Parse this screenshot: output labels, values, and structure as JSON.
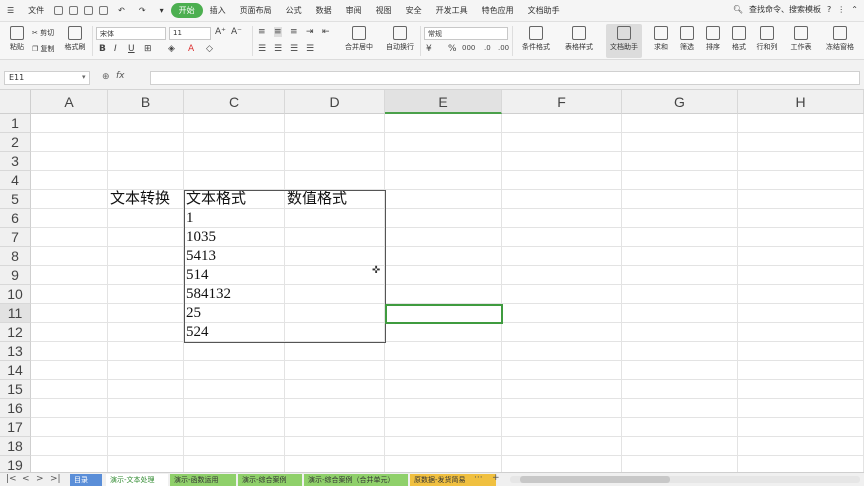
{
  "menubar": {
    "file": "文件",
    "items": [
      "开始",
      "插入",
      "页面布局",
      "公式",
      "数据",
      "审阅",
      "视图",
      "安全",
      "开发工具",
      "特色应用",
      "文档助手"
    ],
    "active_index": 0,
    "search": "查找命令、搜索模板",
    "help": "?"
  },
  "ribbon": {
    "cut": "剪切",
    "paste": "粘贴",
    "copy": "复制",
    "format_painter": "格式刷",
    "font_name": "宋体",
    "font_size": "11",
    "merge_center": "合并居中",
    "auto_wrap": "自动换行",
    "number_format": "常规",
    "conditional_format": "条件格式",
    "table_style": "表格样式",
    "doc_helper": "文档助手",
    "sum": "求和",
    "filter": "筛选",
    "sort": "排序",
    "format": "格式",
    "row_col": "行和列",
    "worksheet": "工作表",
    "freeze": "冻结窗格",
    "bold": "B",
    "italic": "I",
    "underline": "U",
    "percent": "%",
    "thousands": "000"
  },
  "formula_bar": {
    "name_box": "E11",
    "fx": "fx",
    "formula": ""
  },
  "grid": {
    "columns": [
      "A",
      "B",
      "C",
      "D",
      "E",
      "F",
      "G",
      "H"
    ],
    "selected_column": "E",
    "rows": [
      "1",
      "2",
      "3",
      "4",
      "5",
      "6",
      "7",
      "8",
      "9",
      "10",
      "11",
      "12",
      "13",
      "14",
      "15",
      "16",
      "17",
      "18",
      "19"
    ],
    "selected_row": "11",
    "cells": {
      "B5": "文本转换",
      "C5": "文本格式",
      "D5": "数值格式",
      "C6": "1",
      "C7": "1035",
      "C8": "5413",
      "C9": "514",
      "C10": "584132",
      "C11": "25",
      "C12": "524"
    }
  },
  "sheet_tabs": {
    "tabs": [
      "目录",
      "演示-文本处理",
      "演示-函数运用",
      "演示-综合案例",
      "演示-综合案例（合并单元）",
      "原数据-发货简易"
    ],
    "active_index": 1,
    "more": "···",
    "add": "+"
  },
  "colors": {
    "accent_green": "#4caf50",
    "selection_border": "#3f9b3f",
    "tab_yellow": "#f0c040",
    "tab_green": "#8fd06a",
    "tab_blue": "#5a8ed8"
  }
}
